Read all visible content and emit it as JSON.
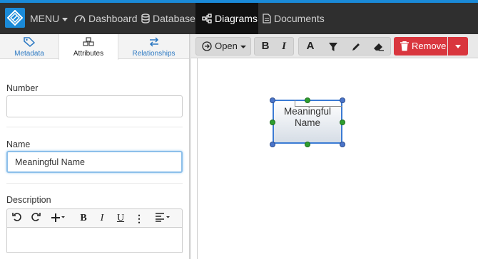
{
  "nav": {
    "menu_label": "MENU",
    "items": [
      {
        "label": "Dashboard"
      },
      {
        "label": "Database"
      },
      {
        "label": "Diagrams"
      },
      {
        "label": "Documents"
      }
    ]
  },
  "tabs": [
    {
      "label": "Metadata"
    },
    {
      "label": "Attributes"
    },
    {
      "label": "Relationships"
    }
  ],
  "form": {
    "number_label": "Number",
    "number_value": "",
    "name_label": "Name",
    "name_value": "Meaningful Name",
    "description_label": "Description"
  },
  "rte": {
    "bold": "B",
    "italic": "I",
    "underline": "U",
    "more": "⋮"
  },
  "toolbar": {
    "open_label": "Open",
    "bold": "B",
    "italic": "I",
    "font": "A",
    "remove_label": "Remove"
  },
  "diagram": {
    "entity_name": "Meaningful Name"
  },
  "colors": {
    "accent": "#1a8ad8",
    "danger": "#d9363e",
    "selection": "#3b7bd4"
  }
}
